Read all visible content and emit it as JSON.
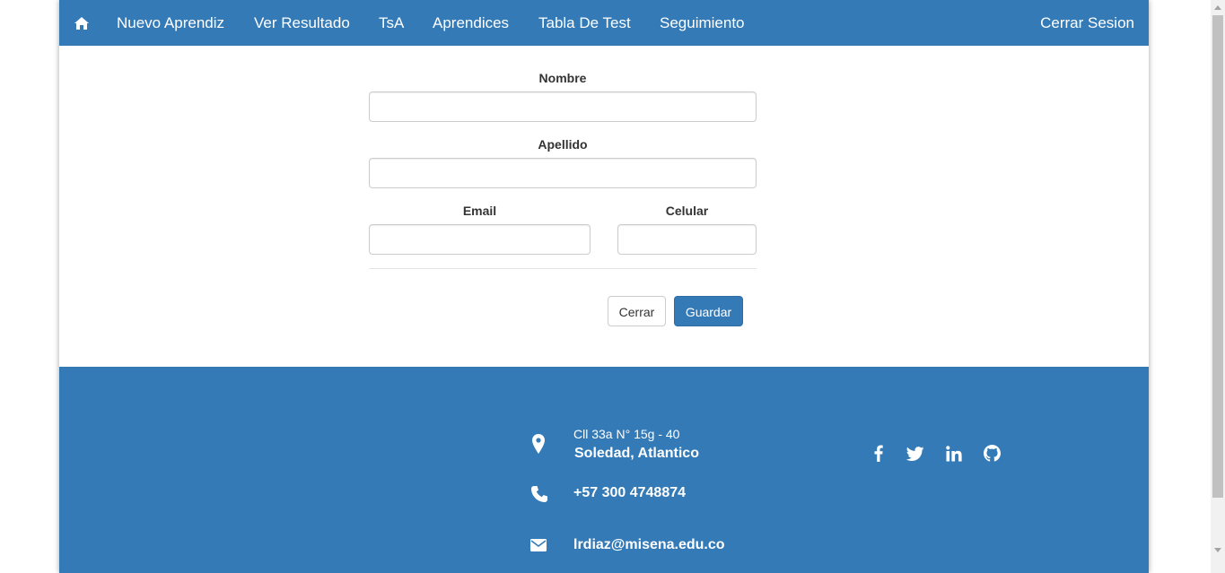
{
  "navbar": {
    "home_icon": "home-icon",
    "items": [
      {
        "label": "Nuevo Aprendiz"
      },
      {
        "label": "Ver Resultado"
      },
      {
        "label": "TsA"
      },
      {
        "label": "Aprendices"
      },
      {
        "label": "Tabla De Test"
      },
      {
        "label": "Seguimiento"
      }
    ],
    "logout_label": "Cerrar Sesion",
    "color": "#337ab7"
  },
  "form": {
    "nombre": {
      "label": "Nombre",
      "value": ""
    },
    "apellido": {
      "label": "Apellido",
      "value": ""
    },
    "email": {
      "label": "Email",
      "value": ""
    },
    "celular": {
      "label": "Celular",
      "value": ""
    },
    "close_label": "Cerrar",
    "save_label": "Guardar"
  },
  "footer": {
    "address_line1": "Cll 33a N° 15g - 40",
    "address_line2": "Soledad, Atlantico",
    "phone": "+57 300 4748874",
    "email": "lrdiaz@misena.edu.co",
    "social_icons": [
      "facebook-icon",
      "twitter-icon",
      "linkedin-icon",
      "github-icon"
    ]
  }
}
